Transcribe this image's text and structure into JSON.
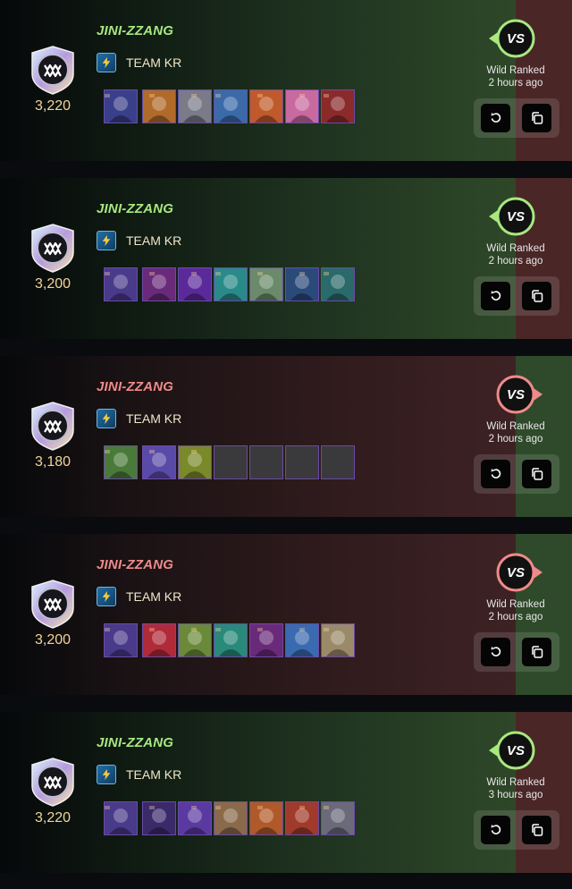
{
  "colors": {
    "win_name": "#a7e87f",
    "loss_name": "#f08a8a",
    "rating": "#f2d596",
    "win_vs": "#a7e87f",
    "loss_vs": "#f08a8a"
  },
  "battles": [
    {
      "result": "win",
      "player_name": "JINI-ZZANG",
      "guild_name": "TEAM KR",
      "rating": "3,220",
      "format_label": "Wild Ranked",
      "time_ago": "2 hours ago",
      "vs_label": "VS",
      "team": [
        "summoner-portrait",
        "monster-portrait",
        "monster-portrait",
        "monster-portrait",
        "monster-portrait",
        "monster-portrait",
        "monster-portrait"
      ],
      "team_colors": [
        "#3a3f8a",
        "#b06a2a",
        "#7a7a88",
        "#3a6aa8",
        "#c05a2a",
        "#c86aa0",
        "#8a2a2a"
      ],
      "empty_slots": 0
    },
    {
      "result": "win",
      "player_name": "JINI-ZZANG",
      "guild_name": "TEAM KR",
      "rating": "3,200",
      "format_label": "Wild Ranked",
      "time_ago": "2 hours ago",
      "vs_label": "VS",
      "team": [
        "summoner-portrait",
        "monster-portrait",
        "monster-portrait",
        "monster-portrait",
        "monster-portrait",
        "monster-portrait",
        "monster-portrait"
      ],
      "team_colors": [
        "#4a3a8a",
        "#6a2a7a",
        "#5a2a9a",
        "#2a8a8a",
        "#6a8a6a",
        "#2a4a7a",
        "#2a6a6a"
      ],
      "empty_slots": 0
    },
    {
      "result": "loss",
      "player_name": "JINI-ZZANG",
      "guild_name": "TEAM KR",
      "rating": "3,180",
      "format_label": "Wild Ranked",
      "time_ago": "2 hours ago",
      "vs_label": "VS",
      "team": [
        "summoner-portrait",
        "monster-portrait",
        "monster-portrait"
      ],
      "team_colors": [
        "#4a7a3a",
        "#5a4aa8",
        "#7a8a2a"
      ],
      "empty_slots": 4
    },
    {
      "result": "loss",
      "player_name": "JINI-ZZANG",
      "guild_name": "TEAM KR",
      "rating": "3,200",
      "format_label": "Wild Ranked",
      "time_ago": "2 hours ago",
      "vs_label": "VS",
      "team": [
        "summoner-portrait",
        "monster-portrait",
        "monster-portrait",
        "monster-portrait",
        "monster-portrait",
        "monster-portrait",
        "monster-portrait"
      ],
      "team_colors": [
        "#4a3a8a",
        "#b02a3a",
        "#6a8a3a",
        "#2a8a7a",
        "#6a2a7a",
        "#3a6ab0",
        "#9a8a6a"
      ],
      "empty_slots": 0
    },
    {
      "result": "win",
      "player_name": "JINI-ZZANG",
      "guild_name": "TEAM KR",
      "rating": "3,220",
      "format_label": "Wild Ranked",
      "time_ago": "3 hours ago",
      "vs_label": "VS",
      "team": [
        "summoner-portrait",
        "monster-portrait",
        "monster-portrait",
        "monster-portrait",
        "monster-portrait",
        "monster-portrait",
        "monster-portrait"
      ],
      "team_colors": [
        "#4a3a8a",
        "#3a2a6a",
        "#5a3aa0",
        "#8a6a4a",
        "#b05a2a",
        "#a03a2a",
        "#6a6a7a"
      ],
      "empty_slots": 0
    }
  ]
}
